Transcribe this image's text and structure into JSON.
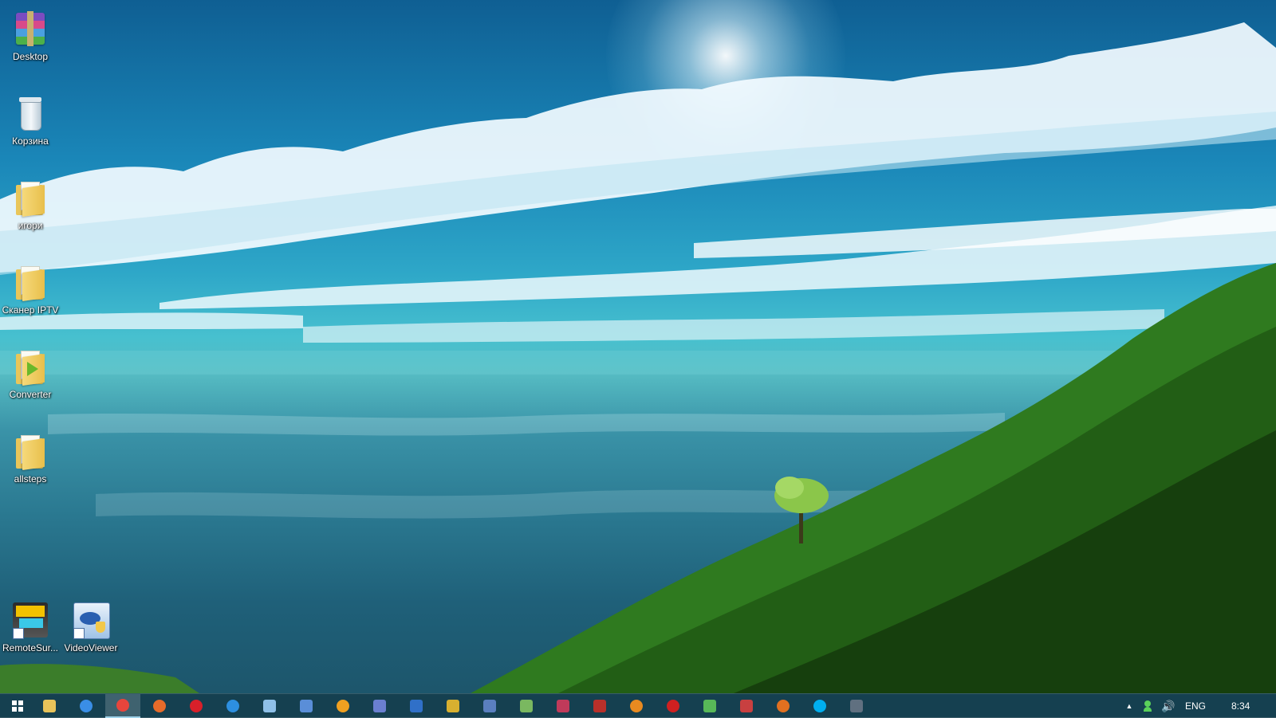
{
  "desktop": {
    "icons": [
      {
        "label": "Desktop",
        "icon": "winrar-archive-icon"
      },
      {
        "label": "Корзина",
        "icon": "recycle-bin-icon"
      },
      {
        "label": "игори",
        "icon": "folder-icon"
      },
      {
        "label": "Сканер IPTV",
        "icon": "folder-icon"
      },
      {
        "label": "Converter",
        "icon": "folder-icon"
      },
      {
        "label": "allsteps",
        "icon": "folder-icon"
      },
      {
        "label": "RemoteSur...",
        "icon": "dvr-net-shortcut-icon"
      },
      {
        "label": "VideoViewer",
        "icon": "videoviewer-shortcut-icon"
      }
    ]
  },
  "taskbar": {
    "start_icon": "windows-start-icon",
    "apps": [
      {
        "icon": "file-explorer-icon",
        "color": "#e8c35a"
      },
      {
        "icon": "browser-globe-icon",
        "color": "#3a8ee6"
      },
      {
        "icon": "chrome-icon",
        "color": "#e8453c",
        "active": true
      },
      {
        "icon": "firefox-icon",
        "color": "#e66b2a"
      },
      {
        "icon": "opera-icon",
        "color": "#d8202a"
      },
      {
        "icon": "teamviewer-icon",
        "color": "#2d8fe0"
      },
      {
        "icon": "network-tool-icon",
        "color": "#8fc0e8"
      },
      {
        "icon": "remote-desktop-icon",
        "color": "#5a8ed8"
      },
      {
        "icon": "avast-icon",
        "color": "#f0a020"
      },
      {
        "icon": "document-editor-icon",
        "color": "#6a7fd0"
      },
      {
        "icon": "save-disk-icon",
        "color": "#3070c8"
      },
      {
        "icon": "puzzle-app-icon",
        "color": "#d8b030"
      },
      {
        "icon": "virtualbox-icon",
        "color": "#5a7fbf"
      },
      {
        "icon": "notepad-plus-icon",
        "color": "#7ab860"
      },
      {
        "icon": "r-studio-icon",
        "color": "#c03a5a"
      },
      {
        "icon": "malware-tool-icon",
        "color": "#b8302a"
      },
      {
        "icon": "daemon-tools-icon",
        "color": "#e88a20"
      },
      {
        "icon": "bug-app-icon",
        "color": "#d02020"
      },
      {
        "icon": "photo-app-icon",
        "color": "#58b858"
      },
      {
        "icon": "flag-app-icon",
        "color": "#c84040"
      },
      {
        "icon": "media-player-icon",
        "color": "#e07020"
      },
      {
        "icon": "skype-icon",
        "color": "#00aff0"
      },
      {
        "icon": "small-app-icon",
        "color": "#607080"
      }
    ],
    "tray": {
      "show_hidden_icon": "chevron-up-icon",
      "user_icon": "user-status-icon",
      "volume_icon": "speaker-icon",
      "language": "ENG",
      "time": "8:34"
    }
  }
}
